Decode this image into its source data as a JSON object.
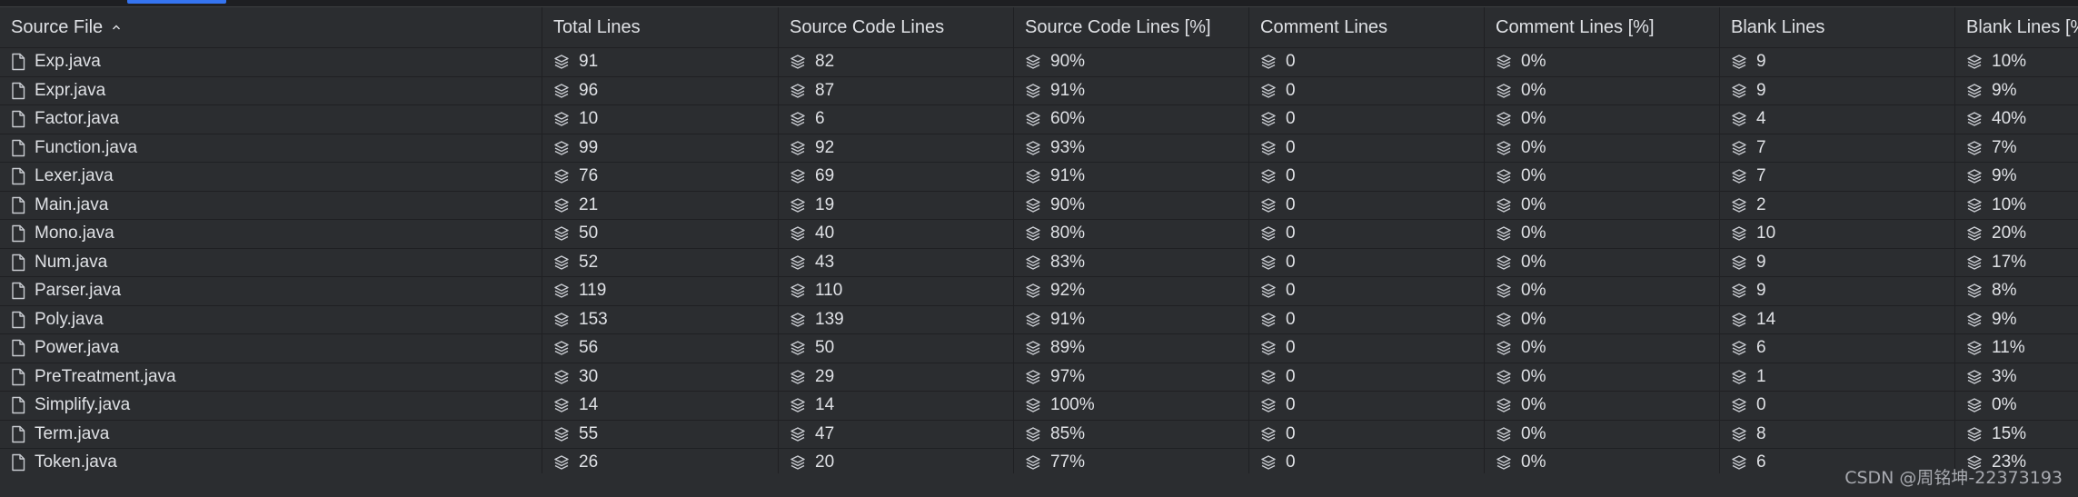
{
  "table": {
    "columns": [
      "Source File",
      "Total Lines",
      "Source Code Lines",
      "Source Code Lines [%]",
      "Comment Lines",
      "Comment Lines [%]",
      "Blank Lines",
      "Blank Lines [%"
    ],
    "sort_indicator": "ascending",
    "rows": [
      [
        "Exp.java",
        "91",
        "82",
        "90%",
        "0",
        "0%",
        "9",
        "10%"
      ],
      [
        "Expr.java",
        "96",
        "87",
        "91%",
        "0",
        "0%",
        "9",
        "9%"
      ],
      [
        "Factor.java",
        "10",
        "6",
        "60%",
        "0",
        "0%",
        "4",
        "40%"
      ],
      [
        "Function.java",
        "99",
        "92",
        "93%",
        "0",
        "0%",
        "7",
        "7%"
      ],
      [
        "Lexer.java",
        "76",
        "69",
        "91%",
        "0",
        "0%",
        "7",
        "9%"
      ],
      [
        "Main.java",
        "21",
        "19",
        "90%",
        "0",
        "0%",
        "2",
        "10%"
      ],
      [
        "Mono.java",
        "50",
        "40",
        "80%",
        "0",
        "0%",
        "10",
        "20%"
      ],
      [
        "Num.java",
        "52",
        "43",
        "83%",
        "0",
        "0%",
        "9",
        "17%"
      ],
      [
        "Parser.java",
        "119",
        "110",
        "92%",
        "0",
        "0%",
        "9",
        "8%"
      ],
      [
        "Poly.java",
        "153",
        "139",
        "91%",
        "0",
        "0%",
        "14",
        "9%"
      ],
      [
        "Power.java",
        "56",
        "50",
        "89%",
        "0",
        "0%",
        "6",
        "11%"
      ],
      [
        "PreTreatment.java",
        "30",
        "29",
        "97%",
        "0",
        "0%",
        "1",
        "3%"
      ],
      [
        "Simplify.java",
        "14",
        "14",
        "100%",
        "0",
        "0%",
        "0",
        "0%"
      ],
      [
        "Term.java",
        "55",
        "47",
        "85%",
        "0",
        "0%",
        "8",
        "15%"
      ],
      [
        "Token.java",
        "26",
        "20",
        "77%",
        "0",
        "0%",
        "6",
        "23%"
      ]
    ]
  },
  "icons": {
    "file": "file-icon",
    "metric": "stack-icon",
    "sort": "sort-ascending-icon"
  },
  "colors": {
    "background": "#2b2d30",
    "grid": "#1f2023",
    "text": "#dfe1e5",
    "accent": "#3574f0"
  },
  "watermark": "CSDN @周铭坤-22373193"
}
